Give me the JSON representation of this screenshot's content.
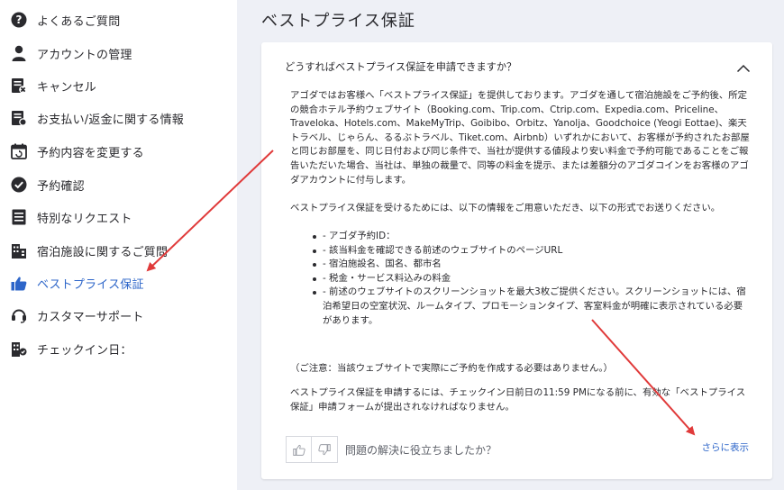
{
  "sidebar": {
    "items": [
      {
        "label": "よくあるご質問",
        "icon": "question-circle-icon",
        "active": false
      },
      {
        "label": "アカウントの管理",
        "icon": "person-icon",
        "active": false
      },
      {
        "label": "キャンセル",
        "icon": "cancel-document-icon",
        "active": false
      },
      {
        "label": "お支払い/返金に関する情報",
        "icon": "payment-document-icon",
        "active": false
      },
      {
        "label": "予約内容を変更する",
        "icon": "calendar-change-icon",
        "active": false
      },
      {
        "label": "予約確認",
        "icon": "check-circle-icon",
        "active": false
      },
      {
        "label": "特別なリクエスト",
        "icon": "list-document-icon",
        "active": false
      },
      {
        "label": "宿泊施設に関するご質問",
        "icon": "building-icon",
        "active": false
      },
      {
        "label": "ベストプライス保証",
        "icon": "thumbs-up-icon",
        "active": true
      },
      {
        "label": "カスタマーサポート",
        "icon": "headset-icon",
        "active": false
      },
      {
        "label": "チェックイン日：",
        "icon": "checkin-building-icon",
        "active": false
      }
    ]
  },
  "main": {
    "title": "ベストプライス保証",
    "question": "どうすればベストプライス保証を申請できますか？",
    "answer_intro": "アゴダではお客様へ「ベストプライス保証」を提供しております。アゴダを通して宿泊施設をご予約後、所定の競合ホテル予約ウェブサイト（Booking.com、Trip.com、Ctrip.com、Expedia.com、Priceline、Traveloka、Hotels.com、MakeMyTrip、Goibibo、Orbitz、Yanolja、Goodchoice (Yeogi Eottae)、楽天トラベル、じゃらん、るるぶトラベル、Tiket.com、Airbnb）いずれかにおいて、お客様が予約されたお部屋と同じお部屋を、同じ日付および同じ条件で、当社が提供する値段より安い料金で予約可能であることをご報告いただいた場合、当社は、単独の裁量で、同等の料金を提示、または差額分のアゴダコインをお客様のアゴダアカウントに付与します。",
    "answer_requirements_intro": "ベストプライス保証を受けるためには、以下の情報をご用意いただき、以下の形式でお送りください。",
    "requirements": [
      "- アゴダ予約ID：",
      "- 該当料金を確認できる前述のウェブサイトのページURL",
      "- 宿泊施設名、国名、都市名",
      "- 税金・サービス料込みの料金",
      "- 前述のウェブサイトのスクリーンショットを最大3枚ご提供ください。スクリーンショットには、宿泊希望日の空室状況、ルームタイプ、プロモーションタイプ、客室料金が明確に表示されている必要があります。"
    ],
    "note": "（ご注意：当該ウェブサイトで実際にご予約を作成する必要はありません。）",
    "claim_text": "ベストプライス保証を申請するには、チェックイン日前日の11:59 PMになる前に、有効な「ベストプライス保証」申請フォームが提出されなければなりません。",
    "feedback_question": "問題の解決に役立ちましたか？",
    "show_more": "さらに表示"
  },
  "colors": {
    "accent": "#2e66c9",
    "main_background": "#eef0f6",
    "annotation_arrow": "#e03a3a"
  }
}
